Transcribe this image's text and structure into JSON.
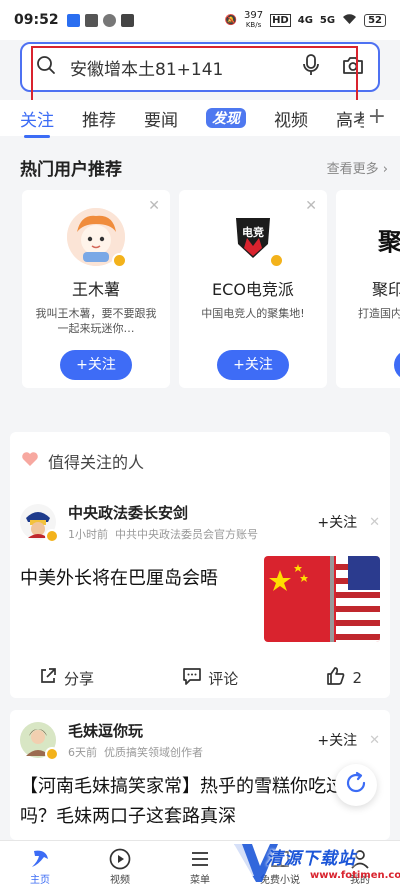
{
  "status_bar": {
    "time": "09:52",
    "net_speed_value": "397",
    "net_speed_unit": "KB/s",
    "hd_label": "HD",
    "signal_1": "4G",
    "signal_2": "5G",
    "battery": "52"
  },
  "search": {
    "query": "安徽增本土81+141"
  },
  "tabs": [
    {
      "label": "关注",
      "active": true
    },
    {
      "label": "推荐"
    },
    {
      "label": "要闻"
    },
    {
      "label": "发现"
    },
    {
      "label": "视频"
    },
    {
      "label": "高考"
    }
  ],
  "hot_users": {
    "title": "热门用户推荐",
    "see_more": "查看更多",
    "follow_label": "+关注",
    "cards": [
      {
        "name": "王木薯",
        "desc": "我叫王木薯，要不要跟我一起来玩迷你…",
        "avatar_icon": "cartoon-kid-avatar"
      },
      {
        "name": "ECO电竞派",
        "desc": "中国电竞人的聚集地!",
        "avatar_icon": "eco-esports-logo",
        "avatar_text": "电竞"
      },
      {
        "name": "聚印",
        "desc": "打造国内视频作品…",
        "avatar_icon": "juyin-logo",
        "avatar_text": "聚"
      }
    ]
  },
  "worth_following": {
    "title": "值得关注的人"
  },
  "feed": [
    {
      "author": "中央政法委长安剑",
      "time": "1小时前",
      "source": "中共中央政法委员会官方账号",
      "follow": "+关注",
      "title": "中美外长将在巴厘岛会晤",
      "share": "分享",
      "comment": "评论",
      "likes": "2"
    },
    {
      "author": "毛妹逗你玩",
      "time": "6天前",
      "source": "优质搞笑领域创作者",
      "follow": "+关注",
      "title": "【河南毛妹搞笑家常】热乎的雪糕你吃过吗？毛妹两口子这套路真深"
    }
  ],
  "bottom_nav": [
    {
      "label": "主页",
      "icon": "home-icon",
      "active": true
    },
    {
      "label": "视频",
      "icon": "play-icon"
    },
    {
      "label": "菜单",
      "icon": "menu-icon"
    },
    {
      "label": "免费小说",
      "icon": "book-icon"
    },
    {
      "label": "我的",
      "icon": "profile-icon"
    }
  ],
  "watermark": {
    "text": "清源下载站",
    "url": "www.fotimen.com"
  },
  "colors": {
    "accent": "#3c6cf5",
    "follow_button": "#3e6cf6",
    "highlight_box": "#d9232e",
    "verified_badge": "#f3b21b"
  }
}
